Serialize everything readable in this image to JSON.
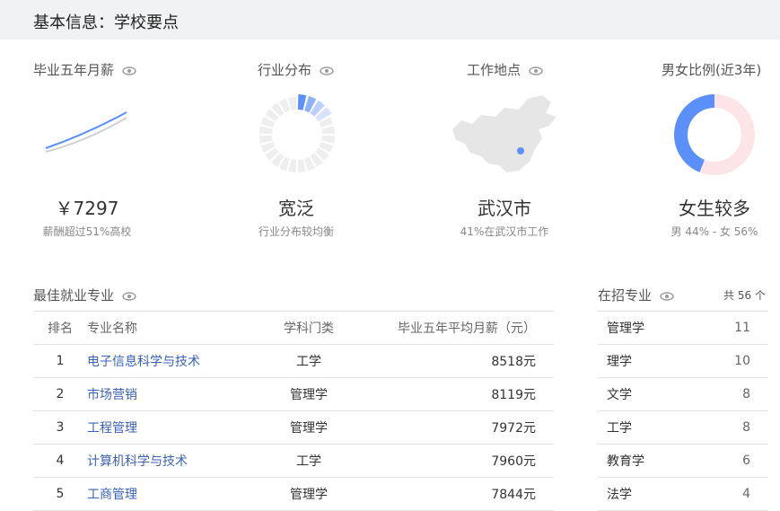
{
  "header": {
    "title": "基本信息：学校要点"
  },
  "cards": [
    {
      "title": "毕业五年月薪",
      "big": "￥7297",
      "sub": "薪酬超过51%高校",
      "icon": "salary-line-icon"
    },
    {
      "title": "行业分布",
      "big": "宽泛",
      "sub": "行业分布较均衡",
      "icon": "industry-donut-icon"
    },
    {
      "title": "工作地点",
      "big": "武汉市",
      "sub": "41%在武汉市工作",
      "icon": "china-map-icon"
    },
    {
      "title": "男女比例(近3年)",
      "big": "女生较多",
      "sub": "男 44% - 女 56%",
      "icon": "gender-donut-icon",
      "male_pct": 44,
      "female_pct": 56,
      "male_color": "#5b8ff9",
      "female_color": "#fde4e6"
    }
  ],
  "best_majors": {
    "title": "最佳就业专业",
    "columns": [
      "排名",
      "专业名称",
      "学科门类",
      "毕业五年平均月薪（元）"
    ],
    "rows": [
      {
        "rank": "1",
        "name": "电子信息科学与技术",
        "category": "工学",
        "salary": "8518元"
      },
      {
        "rank": "2",
        "name": "市场营销",
        "category": "管理学",
        "salary": "8119元"
      },
      {
        "rank": "3",
        "name": "工程管理",
        "category": "管理学",
        "salary": "7972元"
      },
      {
        "rank": "4",
        "name": "计算机科学与技术",
        "category": "工学",
        "salary": "7960元"
      },
      {
        "rank": "5",
        "name": "工商管理",
        "category": "管理学",
        "salary": "7844元"
      }
    ]
  },
  "enrolling": {
    "title": "在招专业",
    "count": "共 56 个",
    "rows": [
      {
        "name": "管理学",
        "num": "11"
      },
      {
        "name": "理学",
        "num": "10"
      },
      {
        "name": "文学",
        "num": "8"
      },
      {
        "name": "工学",
        "num": "8"
      },
      {
        "name": "教育学",
        "num": "6"
      },
      {
        "name": "法学",
        "num": "4"
      }
    ]
  },
  "colors": {
    "accent": "#5b8ff9",
    "link": "#3b62b4",
    "header_bg": "#f1f2f4"
  }
}
